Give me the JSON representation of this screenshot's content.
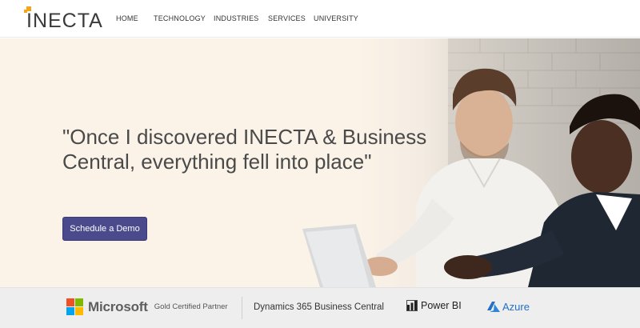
{
  "brand": {
    "name": "INECTA",
    "accent_color": "#f4a51c",
    "text_color": "#3a3a3a"
  },
  "nav": {
    "items": [
      {
        "label": "HOME"
      },
      {
        "label": "TECHNOLOGY"
      },
      {
        "label": "INDUSTRIES"
      },
      {
        "label": "SERVICES"
      },
      {
        "label": "UNIVERSITY"
      }
    ]
  },
  "hero": {
    "quote": "\"Once I discovered INECTA & Business Central, everything fell into place\"",
    "cta_label": "Schedule a Demo",
    "cta_color": "#4a4a8c",
    "background_color": "#fbf3e8",
    "image_icon": "two-men-laptop-photo"
  },
  "partners": {
    "microsoft_name": "Microsoft",
    "microsoft_partner": "Gold Certified Partner",
    "microsoft_colors": [
      "#f25022",
      "#7fba00",
      "#00a4ef",
      "#ffb900"
    ],
    "dynamics": "Dynamics 365 Business Central",
    "powerbi": "Power BI",
    "azure": "Azure",
    "azure_color": "#2470c4"
  }
}
